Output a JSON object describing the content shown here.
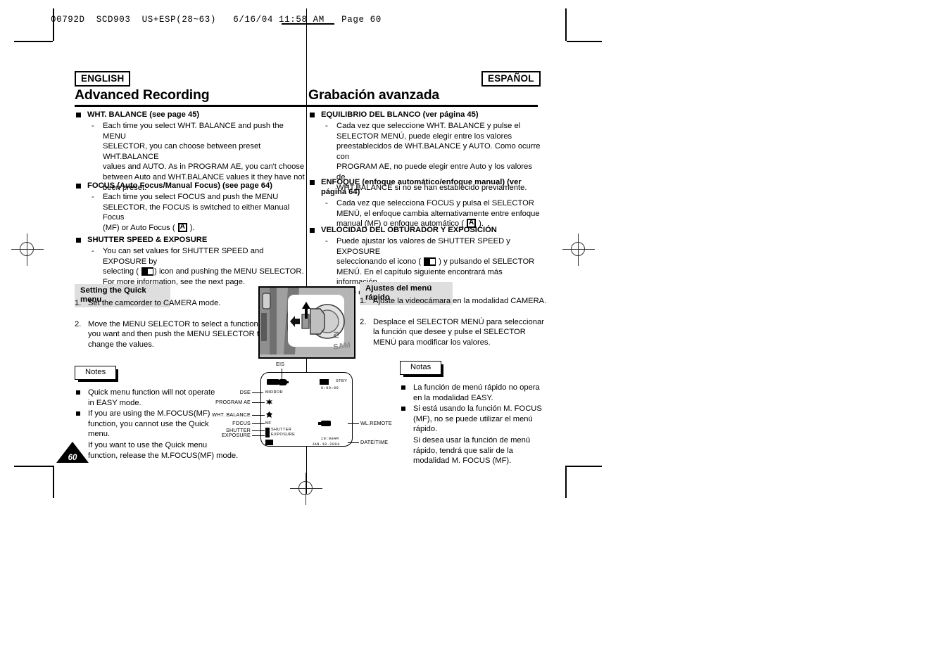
{
  "printer_slug": "00792D  SCD903  US+ESP(28~63)   6/16/04 11:58 AM   Page 60",
  "page_number": "60",
  "english": {
    "language_badge": "ENGLISH",
    "section_title": "Advanced Recording",
    "topics": [
      {
        "heading": "WHT. BALANCE (see page 45)",
        "body_lines": [
          "Each time you select WHT. BALANCE and push the MENU",
          "SELECTOR, you can choose between preset WHT.BALANCE",
          "values and AUTO. As in PROGRAM AE, you can't choose",
          "between Auto and WHT.BALANCE values it they have not",
          "been preset."
        ]
      },
      {
        "heading": "FOCUS (Auto Focus/Manual Focus) (see page 64)",
        "body_lines": [
          "Each time you select FOCUS and push the MENU",
          "SELECTOR, the FOCUS is switched to either Manual Focus",
          "(MF) or Auto Focus ( [A] )."
        ],
        "line_before_icon": "(MF) or Auto Focus ( ",
        "line_after_icon": " )."
      },
      {
        "heading": "SHUTTER SPEED & EXPOSURE",
        "body_lines": [
          "You can set values for SHUTTER SPEED and EXPOSURE by",
          "selecting ( [icon] ) icon and pushing the MENU SELECTOR.",
          "For more information, see the next page."
        ],
        "line_before_icon": "selecting ( ",
        "line_after_icon": ") icon and pushing the MENU SELECTOR."
      }
    ],
    "quickmenu": {
      "subhead": "Setting the Quick menu",
      "steps": [
        {
          "num": "1.",
          "lines": [
            "Set the camcorder to CAMERA mode."
          ]
        },
        {
          "num": "2.",
          "lines": [
            "Move the MENU SELECTOR to select a function",
            "you want and then push the MENU SELECTOR to",
            "change the values."
          ]
        }
      ]
    },
    "notes": {
      "tab_label": "Notes",
      "items": [
        [
          "Quick menu function will not operate",
          "in EASY mode."
        ],
        [
          "If you are using the M.FOCUS(MF)",
          "function, you cannot use the Quick",
          "menu."
        ]
      ],
      "continuation": [
        "If you want to use the Quick menu",
        "function, release the M.FOCUS(MF) mode."
      ]
    }
  },
  "spanish": {
    "language_badge": "ESPAÑOL",
    "section_title": "Grabación avanzada",
    "topics": [
      {
        "heading": "EQUILIBRIO DEL BLANCO (ver página 45)",
        "body_lines": [
          "Cada vez que seleccione WHT. BALANCE y pulse el",
          "SELECTOR MENÚ, puede elegir entre los valores",
          "preestablecidos de WHT.BALANCE y AUTO. Como ocurre con",
          "PROGRAM AE, no puede elegir entre Auto y los valores de",
          "WHT.BALANCE si no se han establecido previamente."
        ]
      },
      {
        "heading": "ENFOQUE (enfoque automático/enfoque manual) (ver página 64)",
        "body_lines": [
          "Cada vez que selecciona FOCUS y pulsa el SELECTOR",
          "MENÚ, el enfoque cambia alternativamente entre enfoque",
          "manual (MF) o enfoque automático ( [A] )."
        ],
        "line_before_icon": "manual (MF) o enfoque automático ( ",
        "line_after_icon": " )."
      },
      {
        "heading": "VELOCIDAD DEL OBTURADOR Y EXPOSICIÓN",
        "body_lines": [
          "Puede ajustar los valores de SHUTTER SPEED y EXPOSURE",
          "seleccionando el icono ( [icon] ) y pulsando el SELECTOR",
          "MENÚ. En el capítulo siguiente encontrará más información",
          "sobre esta función."
        ],
        "line_before_icon": "seleccionando el icono ( ",
        "line_after_icon": " ) y pulsando el SELECTOR"
      }
    ],
    "quickmenu": {
      "subhead": "Ajustes del menú rápido",
      "steps": [
        {
          "num": "1.",
          "lines": [
            "Ajuste la videocámara en la modalidad CAMERA."
          ]
        },
        {
          "num": "2.",
          "lines": [
            "Desplace el SELECTOR MENÚ para seleccionar",
            "la función que desee y pulse el SELECTOR",
            "MENÚ para modificar los valores."
          ]
        }
      ]
    },
    "notes": {
      "tab_label": "Notas",
      "items": [
        [
          "La función de menú rápido no opera",
          "en la modalidad EASY."
        ],
        [
          "Si está usando la función M. FOCUS",
          "(MF), no se puede utilizar el menú",
          "rápido."
        ]
      ],
      "continuation": [
        "Si desea usar la función de menú",
        "rápido, tendrá que salir de la",
        "modalidad M. FOCUS (MF)."
      ]
    }
  },
  "lcd_diagram": {
    "callouts_top": [
      {
        "label": "EIS"
      }
    ],
    "callouts_left": [
      {
        "label": "DSE"
      },
      {
        "label": "PROGRAM AE"
      },
      {
        "label": "WHT. BALANCE"
      },
      {
        "label": "FOCUS"
      },
      {
        "label": "SHUTTER"
      },
      {
        "label": "EXPOSURE"
      }
    ],
    "callouts_right": [
      {
        "label": "WL.REMOTE"
      },
      {
        "label": "DATE/TIME"
      }
    ],
    "osd": {
      "mirror": "MIRROR",
      "mf": "MF",
      "shutter": "SHUTTER",
      "exposure": "EXPOSURE",
      "stby": "STBY",
      "timecode": "0:00:00",
      "time": "10:00AM",
      "date": "JAN.10.2004"
    }
  },
  "colors": {
    "text": "#000000",
    "subhead_bg": "#dedede",
    "photo_bg": "#b9b9b9"
  }
}
